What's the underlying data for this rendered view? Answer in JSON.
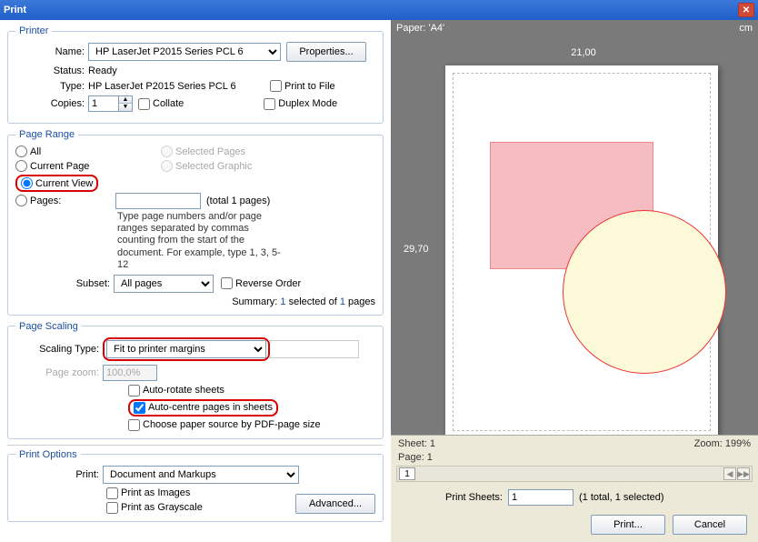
{
  "title": "Print",
  "printer": {
    "legend": "Printer",
    "name_label": "Name:",
    "name_value": "HP LaserJet P2015 Series PCL 6",
    "properties_btn": "Properties...",
    "status_label": "Status:",
    "status_value": "Ready",
    "type_label": "Type:",
    "type_value": "HP LaserJet P2015 Series PCL 6",
    "copies_label": "Copies:",
    "copies_value": "1",
    "collate": "Collate",
    "print_to_file": "Print to File",
    "duplex_mode": "Duplex Mode"
  },
  "page_range": {
    "legend": "Page Range",
    "all": "All",
    "current_page": "Current Page",
    "current_view": "Current View",
    "pages": "Pages:",
    "selected_pages": "Selected Pages",
    "selected_graphic": "Selected Graphic",
    "total_pages": "(total 1 pages)",
    "hint": "Type page numbers and/or page ranges separated by commas counting from the start of the document. For example, type 1, 3, 5-12",
    "subset_label": "Subset:",
    "subset_value": "All pages",
    "reverse_order": "Reverse Order",
    "summary_prefix": "Summary: ",
    "summary_selected": "1",
    "summary_mid": " selected of ",
    "summary_total": "1",
    "summary_suffix": " pages"
  },
  "page_scaling": {
    "legend": "Page Scaling",
    "scaling_type_label": "Scaling Type:",
    "scaling_type_value": "Fit to printer margins",
    "page_zoom_label": "Page zoom:",
    "page_zoom_value": "100,0%",
    "auto_rotate": "Auto-rotate sheets",
    "auto_centre": "Auto-centre pages in sheets",
    "choose_paper": "Choose paper source by PDF-page size"
  },
  "print_options": {
    "legend": "Print Options",
    "print_label": "Print:",
    "print_value": "Document and Markups",
    "print_images": "Print as Images",
    "print_grayscale": "Print as Grayscale",
    "advanced_btn": "Advanced..."
  },
  "preview": {
    "paper_label": "Paper: 'A4'",
    "unit": "cm",
    "width": "21,00",
    "height": "29,70",
    "sheet": "Sheet: 1",
    "zoom": "Zoom: 199%",
    "page": "Page: 1",
    "nav_page": "1",
    "print_sheets_label": "Print Sheets:",
    "print_sheets_value": "1",
    "print_sheets_info": "(1 total, 1 selected)",
    "print_btn": "Print...",
    "cancel_btn": "Cancel"
  }
}
